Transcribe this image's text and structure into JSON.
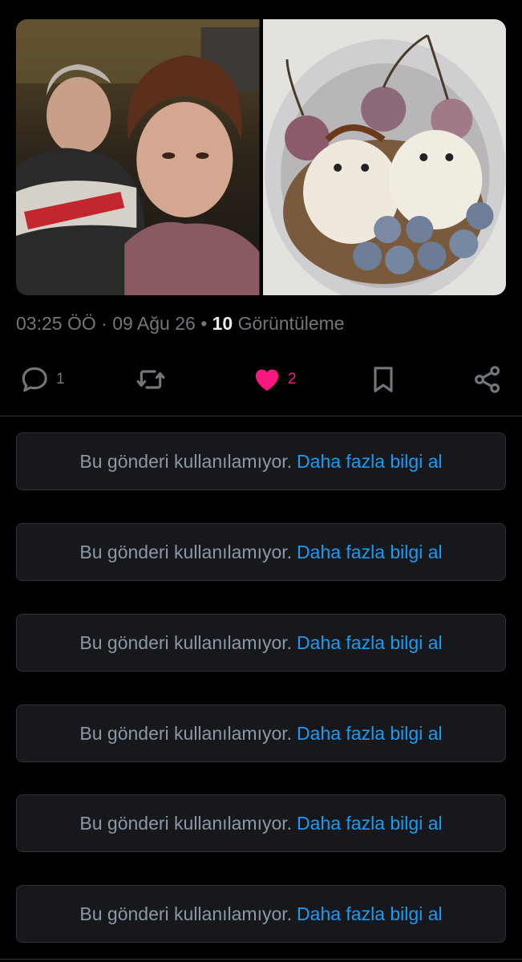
{
  "tweet": {
    "time": "03:25 ÖÖ",
    "separator": "·",
    "date": "09 Ağu 26",
    "views_count": "10",
    "views_label": "Görüntüleme"
  },
  "media": [
    {
      "name": "selfie-photo",
      "description": ""
    },
    {
      "name": "dessert-bowl-photo",
      "description": ""
    }
  ],
  "actions": {
    "reply_count": "1",
    "repost_count": "",
    "like_count": "2",
    "liked": true
  },
  "unavailable_posts": [
    {
      "text": "Bu gönderi kullanılamıyor.",
      "link": "Daha fazla bilgi al"
    },
    {
      "text": "Bu gönderi kullanılamıyor.",
      "link": "Daha fazla bilgi al"
    },
    {
      "text": "Bu gönderi kullanılamıyor.",
      "link": "Daha fazla bilgi al"
    },
    {
      "text": "Bu gönderi kullanılamıyor.",
      "link": "Daha fazla bilgi al"
    },
    {
      "text": "Bu gönderi kullanılamıyor.",
      "link": "Daha fazla bilgi al"
    },
    {
      "text": "Bu gönderi kullanılamıyor.",
      "link": "Daha fazla bilgi al"
    }
  ],
  "colors": {
    "background": "#000000",
    "muted_text": "#71767b",
    "link": "#1d9bf0",
    "like": "#f91880",
    "card_bg": "#16181c",
    "border": "#2f3336"
  },
  "icons": [
    "reply-icon",
    "repost-icon",
    "like-icon",
    "bookmark-icon",
    "share-icon"
  ]
}
